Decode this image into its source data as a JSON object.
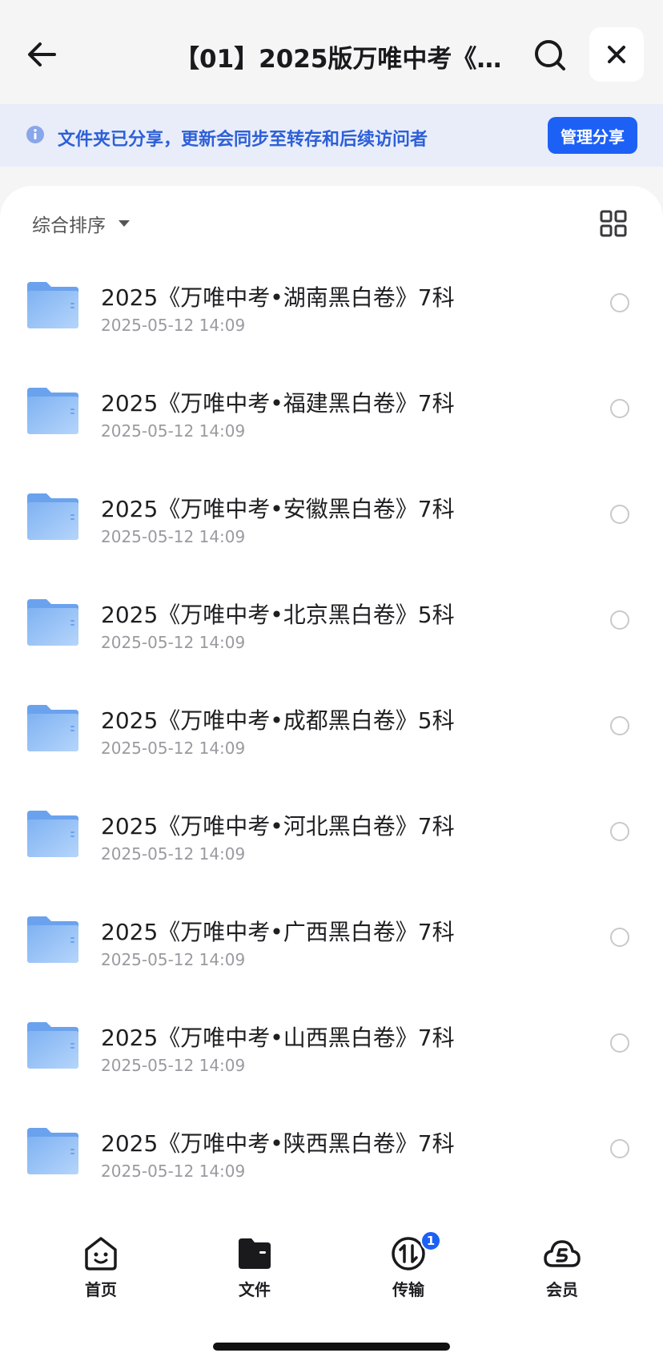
{
  "header": {
    "title": "【01】2025版万唯中考《..."
  },
  "banner": {
    "text": "文件夹已分享，更新会同步至转存和后续访问者",
    "manage_label": "管理分享"
  },
  "toolbar": {
    "sort_label": "综合排序"
  },
  "files": [
    {
      "name": "2025《万唯中考•湖南黑白卷》7科",
      "date": "2025-05-12 14:09"
    },
    {
      "name": "2025《万唯中考•福建黑白卷》7科",
      "date": "2025-05-12 14:09"
    },
    {
      "name": "2025《万唯中考•安徽黑白卷》7科",
      "date": "2025-05-12 14:09"
    },
    {
      "name": "2025《万唯中考•北京黑白卷》5科",
      "date": "2025-05-12 14:09"
    },
    {
      "name": "2025《万唯中考•成都黑白卷》5科",
      "date": "2025-05-12 14:09"
    },
    {
      "name": "2025《万唯中考•河北黑白卷》7科",
      "date": "2025-05-12 14:09"
    },
    {
      "name": "2025《万唯中考•广西黑白卷》7科",
      "date": "2025-05-12 14:09"
    },
    {
      "name": "2025《万唯中考•山西黑白卷》7科",
      "date": "2025-05-12 14:09"
    },
    {
      "name": "2025《万唯中考•陕西黑白卷》7科",
      "date": "2025-05-12 14:09"
    }
  ],
  "nav": {
    "items": [
      {
        "label": "首页",
        "icon": "home-face-icon"
      },
      {
        "label": "文件",
        "icon": "folder-icon"
      },
      {
        "label": "传输",
        "icon": "transfer-icon",
        "badge": "1"
      },
      {
        "label": "会员",
        "icon": "cloud-vip-icon"
      }
    ]
  },
  "colors": {
    "accent": "#1c60f5",
    "banner_bg": "#e8edf9",
    "banner_text": "#2d5fd8",
    "folder": "#8fbdf5"
  }
}
